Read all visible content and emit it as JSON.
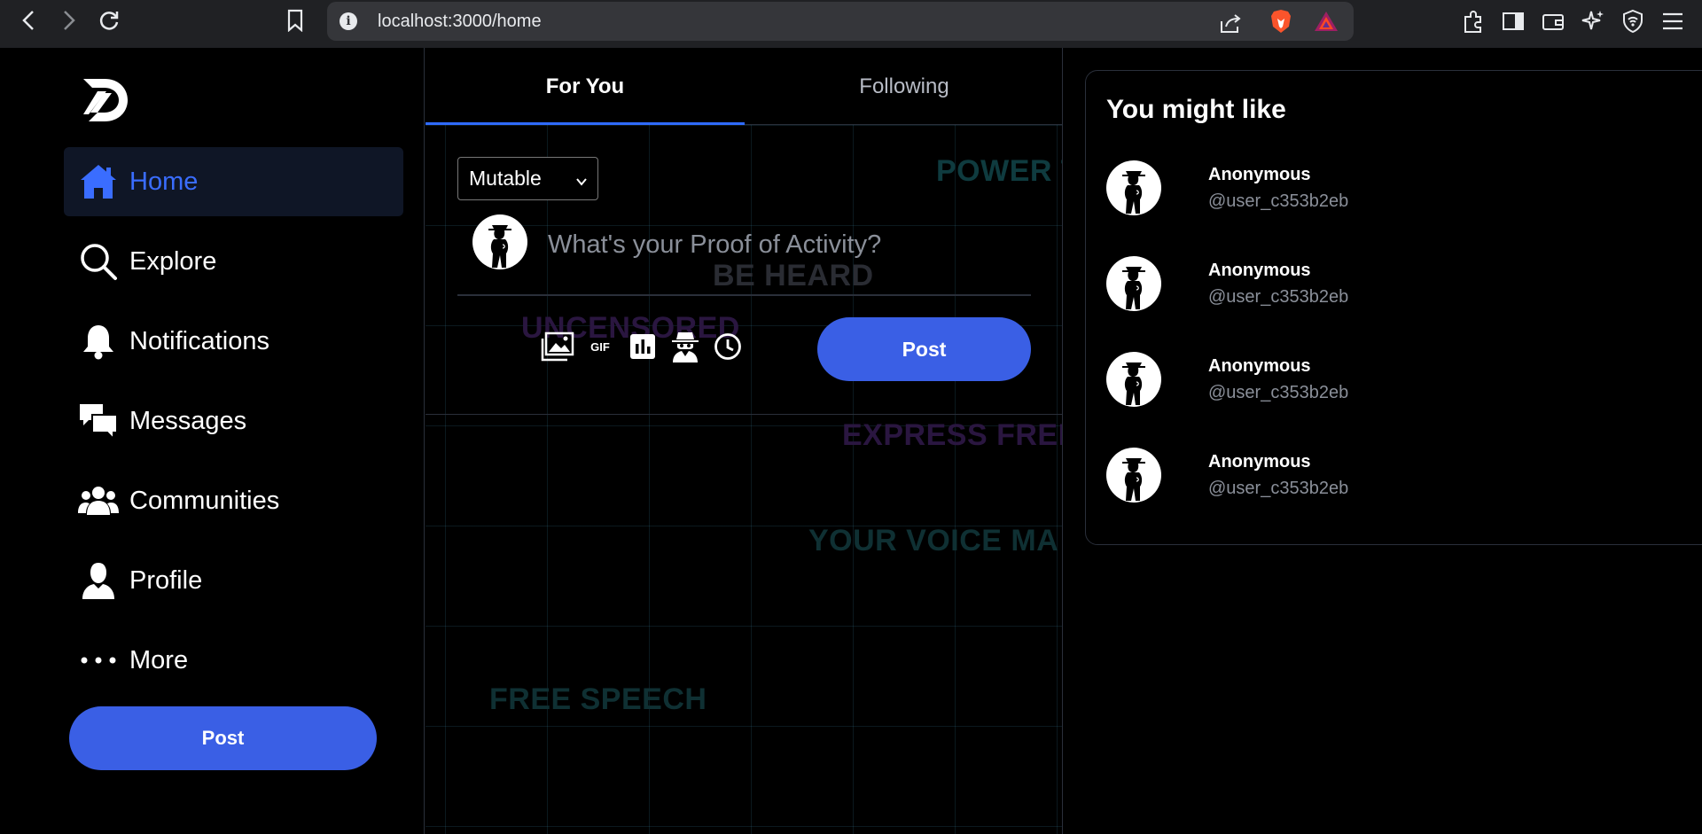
{
  "browser": {
    "url": "localhost:3000/home"
  },
  "sidebar": {
    "items": [
      {
        "label": "Home",
        "icon": "home-icon",
        "active": true
      },
      {
        "label": "Explore",
        "icon": "search-icon"
      },
      {
        "label": "Notifications",
        "icon": "bell-icon"
      },
      {
        "label": "Messages",
        "icon": "chat-icon"
      },
      {
        "label": "Communities",
        "icon": "people-icon"
      },
      {
        "label": "Profile",
        "icon": "user-icon"
      },
      {
        "label": "More",
        "icon": "more-icon"
      }
    ],
    "post_label": "Post"
  },
  "feed": {
    "tabs": [
      {
        "label": "For You",
        "active": true
      },
      {
        "label": "Following"
      }
    ],
    "background_words": [
      "POWER T",
      "BE HEARD",
      "UNCENSORED",
      "EXPRESS FREEL",
      "YOUR VOICE MA",
      "FREE SPEECH"
    ],
    "composer": {
      "visibility": "Mutable",
      "placeholder": "What's your Proof of Activity?",
      "tools": [
        "image-icon",
        "gif-icon",
        "poll-icon",
        "anonymous-icon",
        "schedule-icon"
      ],
      "gif_label": "GIF",
      "post_label": "Post"
    }
  },
  "suggestions": {
    "title": "You might like",
    "users": [
      {
        "name": "Anonymous",
        "handle": "@user_c353b2eb"
      },
      {
        "name": "Anonymous",
        "handle": "@user_c353b2eb"
      },
      {
        "name": "Anonymous",
        "handle": "@user_c353b2eb"
      },
      {
        "name": "Anonymous",
        "handle": "@user_c353b2eb"
      }
    ]
  },
  "colors": {
    "accent": "#3a5fe5",
    "active_text": "#3a6dff",
    "background": "#000000"
  }
}
